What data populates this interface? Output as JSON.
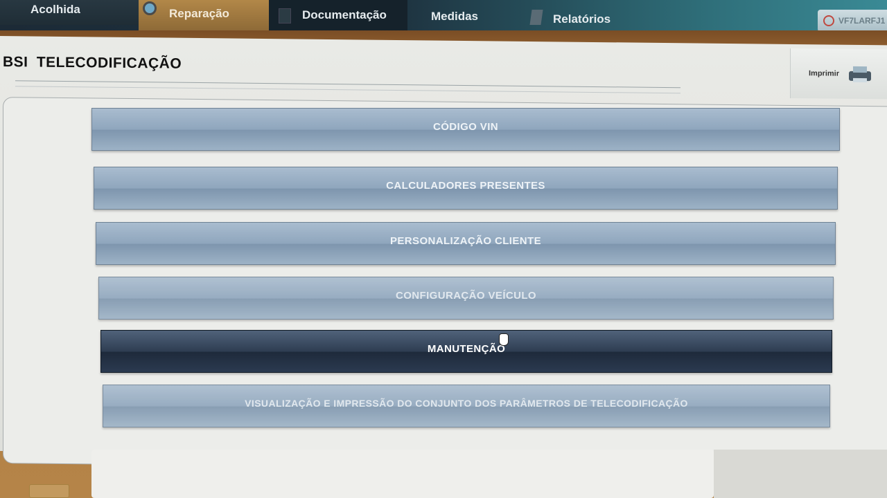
{
  "nav": {
    "tabs": [
      {
        "label": "Acolhida"
      },
      {
        "label": "Reparação"
      },
      {
        "label": "Documentação"
      },
      {
        "label": "Medidas"
      },
      {
        "label": "Relatórios"
      }
    ],
    "user_badge": "VF7LARFJ1"
  },
  "header": {
    "title": "BSI  TELECODIFICAÇÃO",
    "print_label": "Imprimir"
  },
  "menu": {
    "items": [
      {
        "label": "CÓDIGO VIN"
      },
      {
        "label": "CALCULADORES PRESENTES"
      },
      {
        "label": "PERSONALIZAÇÃO CLIENTE"
      },
      {
        "label": "CONFIGURAÇÃO VEÍCULO"
      },
      {
        "label": "MANUTENÇÃO"
      },
      {
        "label": "VISUALIZAÇÃO E IMPRESSÃO DO CONJUNTO DOS PARÂMETROS DE TELECODIFICAÇÃO"
      }
    ],
    "active_index": 4
  },
  "colors": {
    "button": "#8fa6bd",
    "button_active": "#2e3d52",
    "frame": "#b07a3e",
    "nav": "#1e3340"
  }
}
